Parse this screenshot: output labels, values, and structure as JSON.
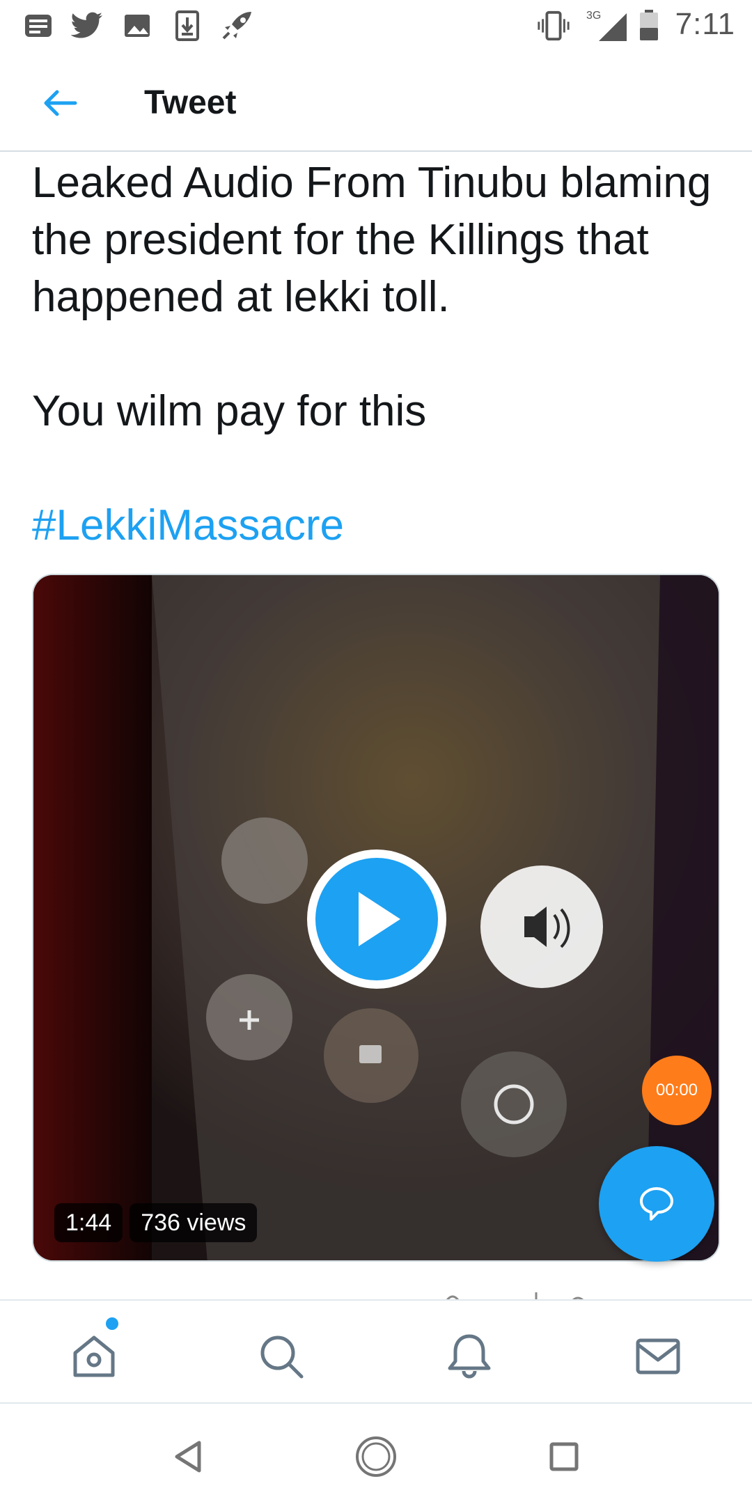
{
  "status_bar": {
    "time": "7:11",
    "network": "3G",
    "left_icons": [
      "news-icon",
      "twitter-icon",
      "image-icon",
      "download-icon",
      "rocket-icon"
    ],
    "right_icons": [
      "vibrate-icon",
      "signal-icon",
      "battery-icon"
    ]
  },
  "header": {
    "title": "Tweet",
    "back_icon": "back-arrow-icon"
  },
  "tweet": {
    "text_line1": "Leaked Audio From Tinubu blaming the president for the Killings that happened at lekki toll.",
    "text_line2": "You wilm pay for this",
    "hashtag": "#LekkiMassacre"
  },
  "video": {
    "duration": "1:44",
    "views": "736 views",
    "overlay_timer": "00:00",
    "play_icon": "play-icon"
  },
  "fab": {
    "icon": "compose-reply-icon"
  },
  "tabs": [
    {
      "name": "home",
      "icon": "home-icon",
      "has_dot": true
    },
    {
      "name": "search",
      "icon": "search-icon"
    },
    {
      "name": "notifications",
      "icon": "bell-icon"
    },
    {
      "name": "messages",
      "icon": "mail-icon"
    }
  ],
  "nav": {
    "back_icon": "nav-back-icon",
    "home_icon": "nav-home-icon",
    "recents_icon": "nav-recents-icon"
  },
  "colors": {
    "accent": "#1da1f2",
    "text": "#14171a",
    "icon_gray": "#657786",
    "timer_orange": "#ff7c1a"
  }
}
